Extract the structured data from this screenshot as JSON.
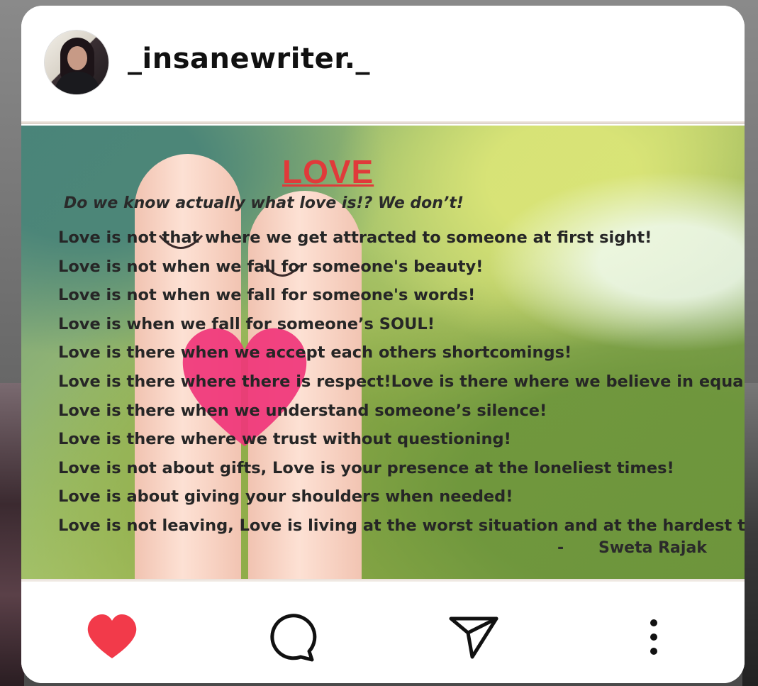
{
  "post": {
    "username": "_insanewriter._",
    "title": "LOVE",
    "subtitle": "Do we know actually what love is!? We don’t!",
    "lines": [
      "Love is not that where we get attracted to someone at first sight!",
      "Love is not when we fall for someone's beauty!",
      "Love is not when we fall for someone's words!",
      "Love is when we fall for someone’s SOUL!",
      "Love is there when we accept each others shortcomings!",
      "Love is there where there is respect!Love is there where we believe in equality!",
      "Love is there when we understand someone’s silence!",
      "Love is there where we trust without questioning!",
      "Love is not about gifts, Love is your presence at the loneliest times!",
      "Love is about giving your shoulders when needed!",
      "Love is not leaving, Love is living at the worst situation and at the hardest times!"
    ],
    "author_dash": "-",
    "author": "Sweta Rajak"
  },
  "actions": {
    "like_icon": "heart-icon",
    "comment_icon": "comment-bubble-icon",
    "share_icon": "send-icon",
    "more_icon": "more-vertical-icon"
  },
  "colors": {
    "like": "#f23a4a",
    "title": "#e03a3a",
    "heart_deco": "#f0357a"
  }
}
